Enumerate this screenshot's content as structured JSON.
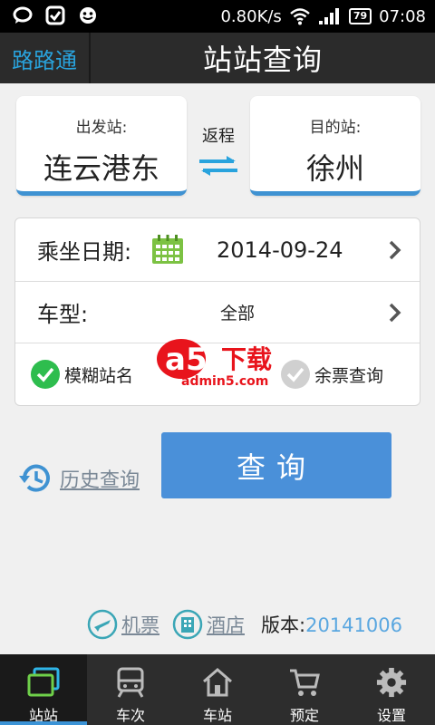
{
  "status_bar": {
    "speed": "0.80K/s",
    "battery": "79",
    "time": "07:08"
  },
  "header": {
    "app_name": "路路通",
    "title": "站站查询"
  },
  "stations": {
    "from_label": "出发站:",
    "from_value": "连云港东",
    "to_label": "目的站:",
    "to_value": "徐州",
    "swap_label": "返程"
  },
  "options": {
    "date_label": "乘坐日期:",
    "date_value": "2014-09-24",
    "type_label": "车型:",
    "type_value": "全部",
    "fuzzy_label": "模糊站名",
    "fuzzy_checked": true,
    "remaining_label": "余票查询",
    "remaining_checked": false
  },
  "watermark": {
    "brand": "a5",
    "text": "下载",
    "site": "admin5.com"
  },
  "actions": {
    "history_label": "历史查询",
    "query_label": "查询"
  },
  "footer": {
    "flight_label": "机票",
    "hotel_label": "酒店",
    "version_label": "版本:",
    "version_value": "20141006"
  },
  "tabs": [
    {
      "label": "站站",
      "icon": "station-to-station-icon",
      "active": true
    },
    {
      "label": "车次",
      "icon": "train-icon",
      "active": false
    },
    {
      "label": "车站",
      "icon": "home-station-icon",
      "active": false
    },
    {
      "label": "预定",
      "icon": "cart-icon",
      "active": false
    },
    {
      "label": "设置",
      "icon": "gear-icon",
      "active": false
    }
  ],
  "colors": {
    "accent": "#3f92d2",
    "check_green": "#2ebd4e",
    "link": "#7a8896"
  }
}
